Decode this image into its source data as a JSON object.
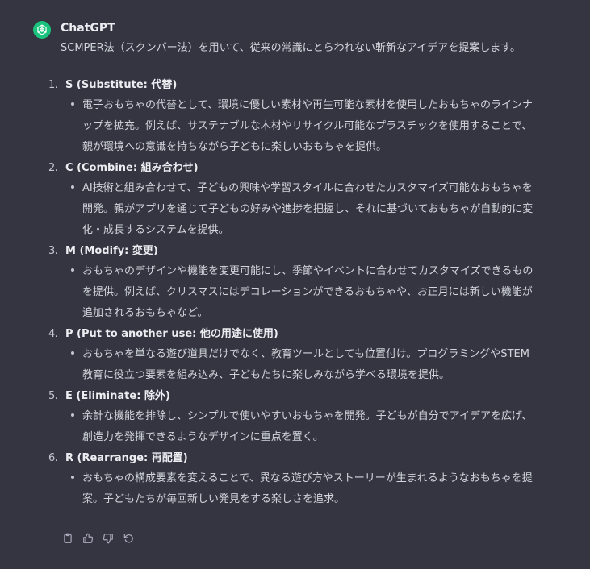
{
  "message": {
    "author": "ChatGPT",
    "avatar_icon": "openai-logo-icon",
    "avatar_color": "#19c37d",
    "intro": "SCMPER法（スクンパー法）を用いて、従来の常識にとらわれない斬新なアイデアを提案します。",
    "items": [
      {
        "number": "1.",
        "heading": "S (Substitute: 代替)",
        "text": "電子おもちゃの代替として、環境に優しい素材や再生可能な素材を使用したおもちゃのラインナップを拡充。例えば、サステナブルな木材やリサイクル可能なプラスチックを使用することで、親が環境への意識を持ちながら子どもに楽しいおもちゃを提供。"
      },
      {
        "number": "2.",
        "heading": "C (Combine: 組み合わせ)",
        "text": "AI技術と組み合わせて、子どもの興味や学習スタイルに合わせたカスタマイズ可能なおもちゃを開発。親がアプリを通じて子どもの好みや進捗を把握し、それに基づいておもちゃが自動的に変化・成長するシステムを提供。"
      },
      {
        "number": "3.",
        "heading": "M (Modify: 変更)",
        "text": "おもちゃのデザインや機能を変更可能にし、季節やイベントに合わせてカスタマイズできるものを提供。例えば、クリスマスにはデコレーションができるおもちゃや、お正月には新しい機能が追加されるおもちゃなど。"
      },
      {
        "number": "4.",
        "heading": "P (Put to another use: 他の用途に使用)",
        "text": "おもちゃを単なる遊び道具だけでなく、教育ツールとしても位置付け。プログラミングやSTEM教育に役立つ要素を組み込み、子どもたちに楽しみながら学べる環境を提供。"
      },
      {
        "number": "5.",
        "heading": "E (Eliminate: 除外)",
        "text": "余計な機能を排除し、シンプルで使いやすいおもちゃを開発。子どもが自分でアイデアを広げ、創造力を発揮できるようなデザインに重点を置く。"
      },
      {
        "number": "6.",
        "heading": "R (Rearrange: 再配置)",
        "text": "おもちゃの構成要素を変えることで、異なる遊び方やストーリーが生まれるようなおもちゃを提案。子どもたちが毎回新しい発見をする楽しさを追求。"
      }
    ]
  },
  "actions": [
    {
      "icon": "clipboard-icon"
    },
    {
      "icon": "thumbs-up-icon"
    },
    {
      "icon": "thumbs-down-icon"
    },
    {
      "icon": "regenerate-icon"
    }
  ]
}
